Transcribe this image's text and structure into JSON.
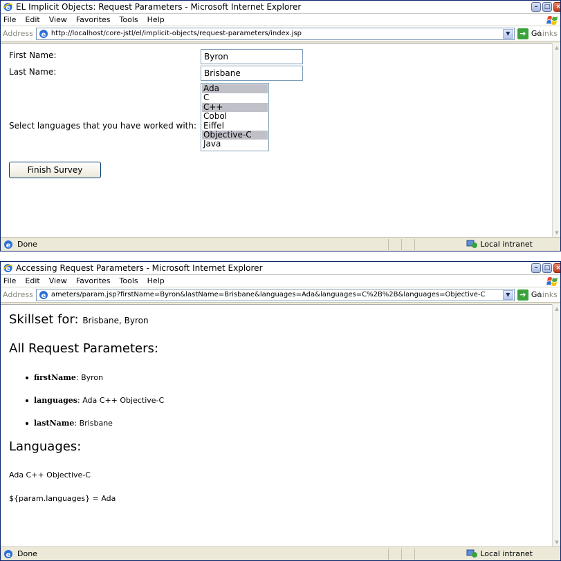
{
  "window1": {
    "title": "EL Implicit Objects: Request Parameters - Microsoft Internet Explorer",
    "menu": [
      "File",
      "Edit",
      "View",
      "Favorites",
      "Tools",
      "Help"
    ],
    "address_label": "Address",
    "address_url": "http://localhost/core-jstl/el/implicit-objects/request-parameters/index.jsp",
    "go_label": "Go",
    "links_label": "Links",
    "status_text": "Done",
    "zone_text": "Local intranet",
    "form": {
      "first_name_label": "First Name:",
      "first_name_value": "Byron",
      "last_name_label": "Last Name:",
      "last_name_value": "Brisbane",
      "languages_label": "Select languages that you have worked with:",
      "languages": [
        {
          "name": "Ada",
          "selected": true
        },
        {
          "name": "C",
          "selected": false
        },
        {
          "name": "C++",
          "selected": true
        },
        {
          "name": "Cobol",
          "selected": false
        },
        {
          "name": "Eiffel",
          "selected": false
        },
        {
          "name": "Objective-C",
          "selected": true
        },
        {
          "name": "Java",
          "selected": false
        }
      ],
      "submit_label": "Finish Survey"
    }
  },
  "window2": {
    "title": "Accessing Request Parameters - Microsoft Internet Explorer",
    "menu": [
      "File",
      "Edit",
      "View",
      "Favorites",
      "Tools",
      "Help"
    ],
    "address_label": "Address",
    "address_url": "ameters/param.jsp?firstName=Byron&lastName=Brisbane&languages=Ada&languages=C%2B%2B&languages=Objective-C",
    "go_label": "Go",
    "links_label": "Links",
    "status_text": "Done",
    "zone_text": "Local intranet",
    "page": {
      "skillset_heading": "Skillset for:",
      "skillset_name": "Brisbane, Byron",
      "all_params_heading": "All Request Parameters:",
      "params": [
        {
          "key": "firstName",
          "value": ": Byron"
        },
        {
          "key": "languages",
          "value": ": Ada C++ Objective-C"
        },
        {
          "key": "lastName",
          "value": ": Brisbane"
        }
      ],
      "languages_heading": "Languages:",
      "languages_line": "Ada C++ Objective-C",
      "param_expression": "${param.languages} = Ada"
    }
  }
}
